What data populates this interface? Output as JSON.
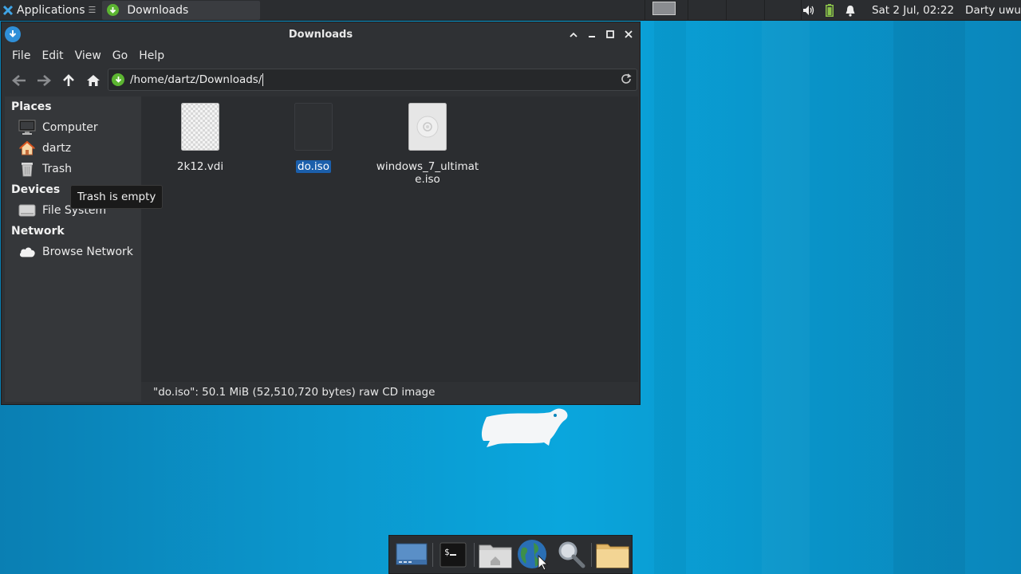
{
  "top_panel": {
    "applications_label": "Applications",
    "applications_suffix": "☰",
    "task_label": "Downloads",
    "clock": "Sat  2 Jul, 02:22",
    "user": "Darty uwu"
  },
  "window": {
    "title": "Downloads",
    "menu": [
      "File",
      "Edit",
      "View",
      "Go",
      "Help"
    ],
    "location": "/home/dartz/Downloads/"
  },
  "sidebar": {
    "places_header": "Places",
    "places": [
      {
        "label": "Computer",
        "icon": "computer-icon"
      },
      {
        "label": "dartz",
        "icon": "home-folder-icon"
      },
      {
        "label": "Trash",
        "icon": "trash-icon"
      }
    ],
    "devices_header": "Devices",
    "devices": [
      {
        "label": "File System",
        "icon": "drive-icon"
      }
    ],
    "network_header": "Network",
    "network": [
      {
        "label": "Browse Network",
        "icon": "cloud-icon"
      }
    ]
  },
  "files": [
    {
      "name": "2k12.vdi",
      "icon": "vdi-file-icon",
      "selected": false
    },
    {
      "name": "do.iso",
      "icon": "iso-file-icon",
      "selected": true
    },
    {
      "name_line1": "windows_7_ultimat",
      "name_line2": "e.iso",
      "icon": "disc-image-icon",
      "selected": false
    }
  ],
  "tooltip": "Trash is empty",
  "status": "\"do.iso\": 50.1 MiB (52,510,720 bytes) raw CD image",
  "dock": [
    "show-desktop-icon",
    "terminal-icon",
    "home-folder-icon",
    "web-browser-icon",
    "search-icon",
    "folder-icon"
  ],
  "colors": {
    "accent": "#1b5fab",
    "download_green": "#5cb531",
    "desktop_blue": "#0aa6dd"
  }
}
